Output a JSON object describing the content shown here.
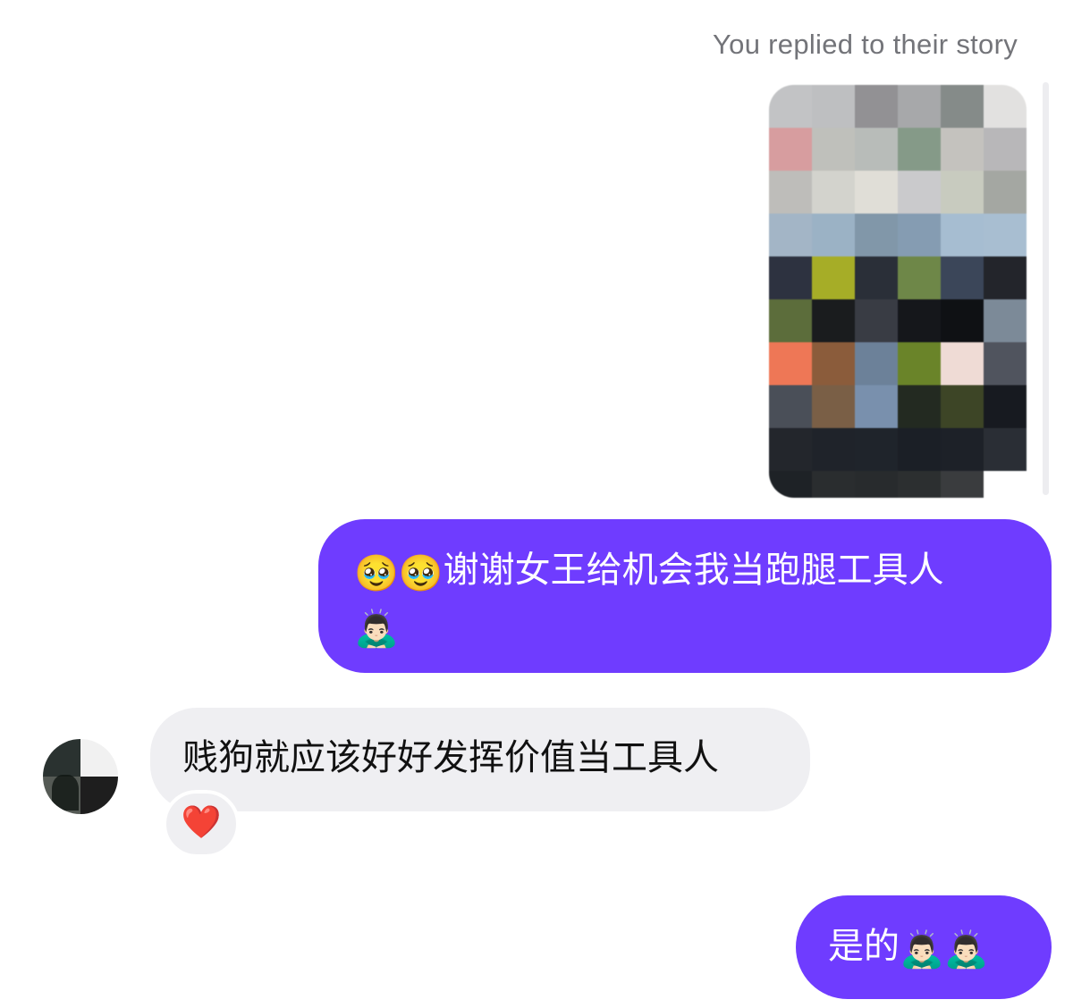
{
  "story_reply": {
    "caption": "You replied to their story",
    "thumbnail_colors": [
      "#c2c3c5",
      "#bebfc1",
      "#929194",
      "#a7a8aa",
      "#858b89",
      "#e2e1e0",
      "#d79d9f",
      "#bfc0bb",
      "#b8bcb9",
      "#859a88",
      "#c4c2be",
      "#b8b7b9",
      "#bebdba",
      "#d3d3cd",
      "#e0ded7",
      "#cacacc",
      "#c8cbbf",
      "#a4a7a2",
      "#a3b5c6",
      "#9bb2c5",
      "#8197a9",
      "#859cb2",
      "#a6bdd1",
      "#a8bed1",
      "#2d3240",
      "#a6ad27",
      "#2a2f38",
      "#6e8748",
      "#3b4659",
      "#23252b",
      "#5c6d3b",
      "#1a1c1e",
      "#393c44",
      "#15171b",
      "#0f1114",
      "#7c8a98",
      "#ee7756",
      "#8b5c3b",
      "#6c8199",
      "#6a8429",
      "#efdbd5",
      "#50545e",
      "#4a4f58",
      "#7a5f46",
      "#7990ad",
      "#232a21",
      "#3d4526",
      "#171a20",
      "#23262c",
      "#1f232a",
      "#1f242b",
      "#1b1f26",
      "#1d2128",
      "#2a2e35",
      "#1e2226",
      "#2a2d2f",
      "#282b2d",
      "#2c2f30",
      "#3a3c3e",
      "#ffffff"
    ]
  },
  "messages": [
    {
      "sender": "me",
      "text": "谢谢女王给机会我当跑腿工具人",
      "emoji_before": "🥹🥹",
      "emoji_after": "🙇🏻‍♂️"
    },
    {
      "sender": "them",
      "text": "贱狗就应该好好发挥价值当工具人",
      "reaction": "❤️"
    },
    {
      "sender": "me",
      "text": "是的",
      "emoji_after": "🙇🏻‍♂️🙇🏻‍♂️"
    }
  ],
  "colors": {
    "outgoing_bubble": "#6f3cff",
    "incoming_bubble": "#efeff2",
    "caption": "#737479"
  }
}
